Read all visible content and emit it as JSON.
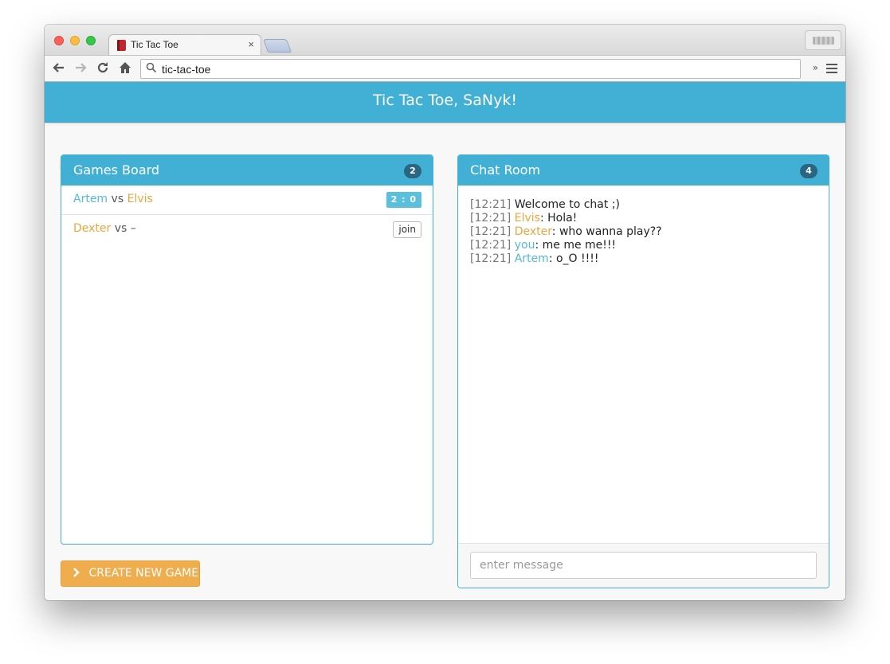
{
  "browser": {
    "tab_title": "Tic Tac Toe",
    "tab_close": "×",
    "url": "tic-tac-toe",
    "extensions_glyph": "»"
  },
  "header": {
    "title": "Tic Tac Toe, SaNyk!"
  },
  "games_board": {
    "title": "Games Board",
    "count": "2",
    "games": [
      {
        "player1": "Artem",
        "vs": "vs",
        "player2": "Elvis",
        "score": "2 : 0"
      },
      {
        "player1": "Dexter",
        "vs": "vs",
        "player2": "–",
        "action": "join"
      }
    ],
    "create_button": "CREATE NEW GAME"
  },
  "chat_room": {
    "title": "Chat Room",
    "count": "4",
    "messages": [
      {
        "time": "[12:21]",
        "user": "",
        "text": "Welcome to chat ;)"
      },
      {
        "time": "[12:21]",
        "user": "Elvis",
        "text": ": Hola!"
      },
      {
        "time": "[12:21]",
        "user": "Dexter",
        "text": ": who wanna play??"
      },
      {
        "time": "[12:21]",
        "user": "you",
        "text": ": me me me!!!"
      },
      {
        "time": "[12:21]",
        "user": "Artem",
        "text": ": o_O !!!!"
      }
    ],
    "input_placeholder": "enter message"
  },
  "colors": {
    "accent": "#41b0d4",
    "player_blue": "#55b9d9",
    "player_orange": "#eea53e",
    "create_button": "#f0ad4e"
  },
  "icons": {
    "back": "back-arrow-icon",
    "forward": "forward-arrow-icon",
    "reload": "reload-icon",
    "home": "home-icon",
    "search": "search-icon",
    "menu": "hamburger-menu-icon",
    "create": "chevron-right-icon"
  }
}
